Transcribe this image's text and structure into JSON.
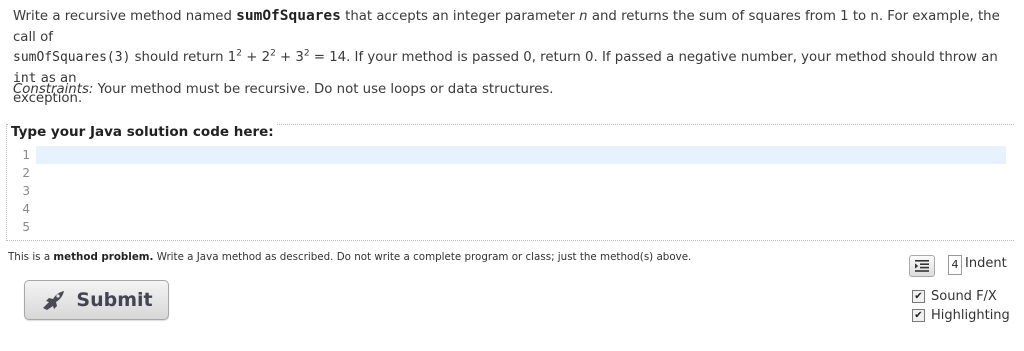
{
  "prompt": {
    "p1_a": "Write a recursive method named ",
    "method_name": "sumOfSquares",
    "p1_b": " that accepts an integer parameter ",
    "param": "n",
    "p1_c": " and returns the sum of squares from 1 to n. For example, the call of",
    "example_call": "sumOfSquares(3)",
    "p2_a": " should return 1",
    "sup2a": "2",
    "p2_b": " + 2",
    "sup2b": "2",
    "p2_c": " + 3",
    "sup2c": "2",
    "p2_d": " = 14. If your method is passed 0, return 0. If passed a negative number, your method should throw an ",
    "int_code": "int",
    "p2_e": " as an",
    "p3": "exception."
  },
  "constraints": {
    "label": "Constraints:",
    "text": " Your method must be recursive. Do not use loops or data structures."
  },
  "editor": {
    "legend": "Type your Java solution code here:",
    "line_numbers": [
      "1",
      "2",
      "3",
      "4",
      "5"
    ]
  },
  "note": {
    "a": "This is a ",
    "bold": "method problem.",
    "b": " Write a Java method as described. Do not write a complete program or class; just the method(s) above."
  },
  "submit_label": "Submit",
  "indent": {
    "value": "4",
    "label": "Indent"
  },
  "options": [
    {
      "label": "Sound F/X",
      "checked": true
    },
    {
      "label": "Highlighting",
      "checked": true
    }
  ],
  "colors": {
    "active_line": "#e8f2fe",
    "button_text": "#445566"
  }
}
